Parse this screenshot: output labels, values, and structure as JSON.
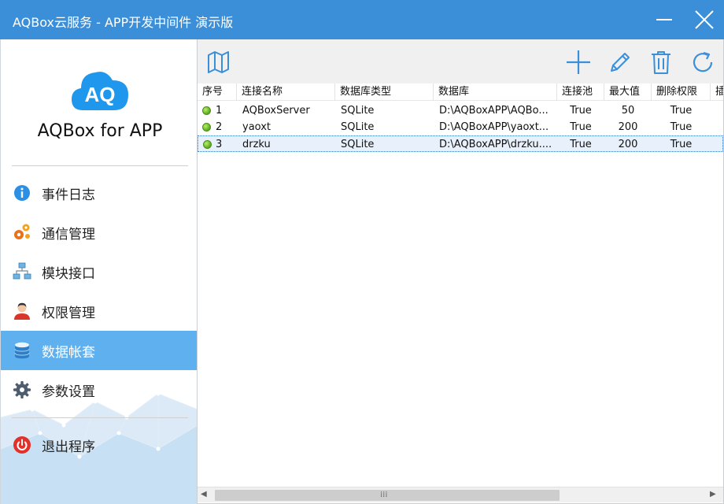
{
  "window": {
    "title": "AQBox云服务 - APP开发中间件 演示版",
    "minimize_icon": "minimize-icon",
    "close_icon": "close-icon",
    "titlebar_color": "#3b8fd9"
  },
  "sidebar": {
    "logo_text": "AQ",
    "app_name": "AQBox for APP",
    "active_color": "#5fb0ef",
    "items": [
      {
        "label": "事件日志",
        "icon": "info-icon"
      },
      {
        "label": "通信管理",
        "icon": "gears-icon"
      },
      {
        "label": "模块接口",
        "icon": "network-icon"
      },
      {
        "label": "权限管理",
        "icon": "user-icon"
      },
      {
        "label": "数据帐套",
        "icon": "database-icon",
        "active": true
      },
      {
        "label": "参数设置",
        "icon": "gear-icon"
      },
      {
        "label": "退出程序",
        "icon": "power-icon"
      }
    ]
  },
  "toolbar": {
    "buttons": [
      "map-icon",
      "plus-icon",
      "pencil-icon",
      "trash-icon",
      "refresh-icon"
    ]
  },
  "table": {
    "columns": [
      "序号",
      "连接名称",
      "数据库类型",
      "数据库",
      "连接池",
      "最大值",
      "删除权限",
      "插"
    ],
    "rows": [
      {
        "no": "1",
        "name": "AQBoxServer",
        "type": "SQLite",
        "db": "D:\\AQBoxAPP\\AQBo...",
        "pool": "True",
        "max": "50",
        "del": "True"
      },
      {
        "no": "2",
        "name": "yaoxt",
        "type": "SQLite",
        "db": "D:\\AQBoxAPP\\yaoxt...",
        "pool": "True",
        "max": "200",
        "del": "True"
      },
      {
        "no": "3",
        "name": "drzku",
        "type": "SQLite",
        "db": "D:\\AQBoxAPP\\drzku....",
        "pool": "True",
        "max": "200",
        "del": "True",
        "selected": true
      }
    ]
  },
  "scrollbar": {
    "left_arrow": "◀",
    "right_arrow": "▶",
    "grip": "⁞⁞⁞"
  }
}
